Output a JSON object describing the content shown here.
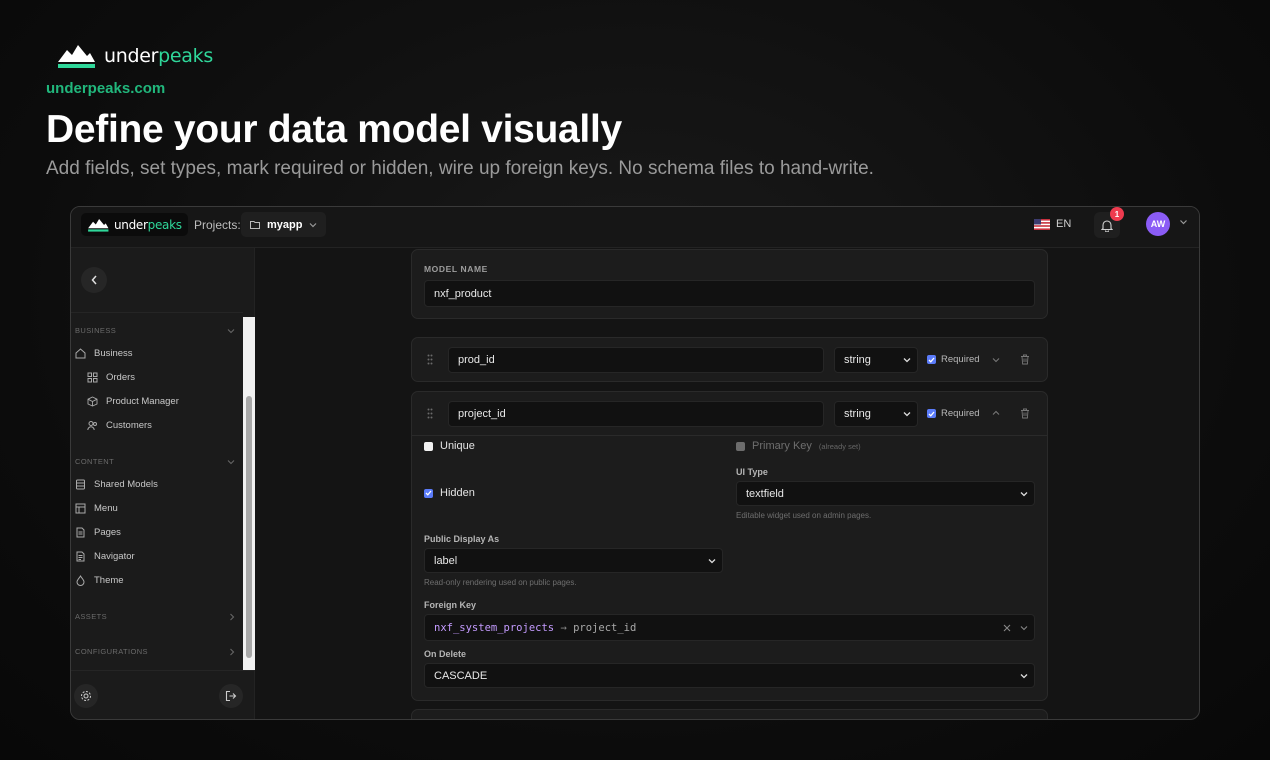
{
  "marketing": {
    "brand_under": "under",
    "brand_peaks": "peaks",
    "site": "underpeaks.com",
    "headline": "Define your data model visually",
    "subheadline": "Add fields, set types, mark required or hidden, wire up foreign keys. No schema files to hand-write."
  },
  "topbar": {
    "logo_under": "under",
    "logo_peaks": "peaks",
    "projects_label": "Projects:",
    "project_name": "myapp",
    "language": "EN",
    "notification_count": "1",
    "avatar_initials": "AW"
  },
  "sidebar": {
    "sections": [
      {
        "title": "BUSINESS",
        "items": [
          "Business",
          "Orders",
          "Product Manager",
          "Customers"
        ]
      },
      {
        "title": "CONTENT",
        "items": [
          "Shared Models",
          "Menu",
          "Pages",
          "Navigator",
          "Theme"
        ]
      },
      {
        "title": "ASSETS"
      },
      {
        "title": "CONFIGURATIONS"
      }
    ]
  },
  "model": {
    "name_label": "MODEL NAME",
    "name_value": "nxf_product"
  },
  "fields": [
    {
      "name": "prod_id",
      "type": "string",
      "required_label": "Required",
      "required": true
    },
    {
      "name": "project_id",
      "type": "string",
      "required_label": "Required",
      "required": true
    }
  ],
  "field_details": {
    "unique_label": "Unique",
    "primary_key_label": "Primary Key",
    "primary_key_note": "(already set)",
    "ui_type_label": "UI Type",
    "ui_type_value": "textfield",
    "ui_type_hint": "Editable widget used on admin pages.",
    "hidden_label": "Hidden",
    "public_display_label": "Public Display As",
    "public_display_value": "label",
    "public_display_hint": "Read-only rendering used on public pages.",
    "foreign_key_label": "Foreign Key",
    "fk_table": "nxf_system_projects",
    "fk_arrow": "→",
    "fk_column": "project_id",
    "on_delete_label": "On Delete",
    "on_delete_value": "CASCADE"
  },
  "colors": {
    "accent_green": "#2fd79a",
    "checkbox_blue": "#5b7cfa",
    "avatar_purple": "#8b5cf6",
    "badge_red": "#ee3b4f",
    "fk_table_color": "#c49bff"
  }
}
